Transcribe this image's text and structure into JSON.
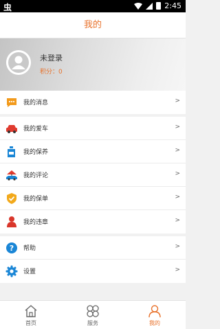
{
  "status_bar": {
    "left_icon_text": "虫",
    "time": "2:45"
  },
  "header": {
    "title": "我的"
  },
  "profile": {
    "name": "未登录",
    "points": "积分：0"
  },
  "menu_group_1": [
    {
      "label": "我的消息",
      "icon": "message-icon"
    }
  ],
  "menu_group_2": [
    {
      "label": "我的爱车",
      "icon": "car-icon"
    },
    {
      "label": "我的保养",
      "icon": "maintenance-icon"
    },
    {
      "label": "我的评论",
      "icon": "review-icon"
    },
    {
      "label": "我的保单",
      "icon": "insurance-icon"
    },
    {
      "label": "我的违章",
      "icon": "person-icon"
    }
  ],
  "menu_group_3": [
    {
      "label": "帮助",
      "icon": "help-icon"
    },
    {
      "label": "设置",
      "icon": "settings-icon"
    }
  ],
  "chevron": ">",
  "tabs": [
    {
      "label": "首页",
      "icon": "home-icon"
    },
    {
      "label": "服务",
      "icon": "services-icon"
    },
    {
      "label": "我的",
      "icon": "user-icon"
    }
  ],
  "colors": {
    "accent": "#e8712a",
    "status_bar": "#000000"
  }
}
